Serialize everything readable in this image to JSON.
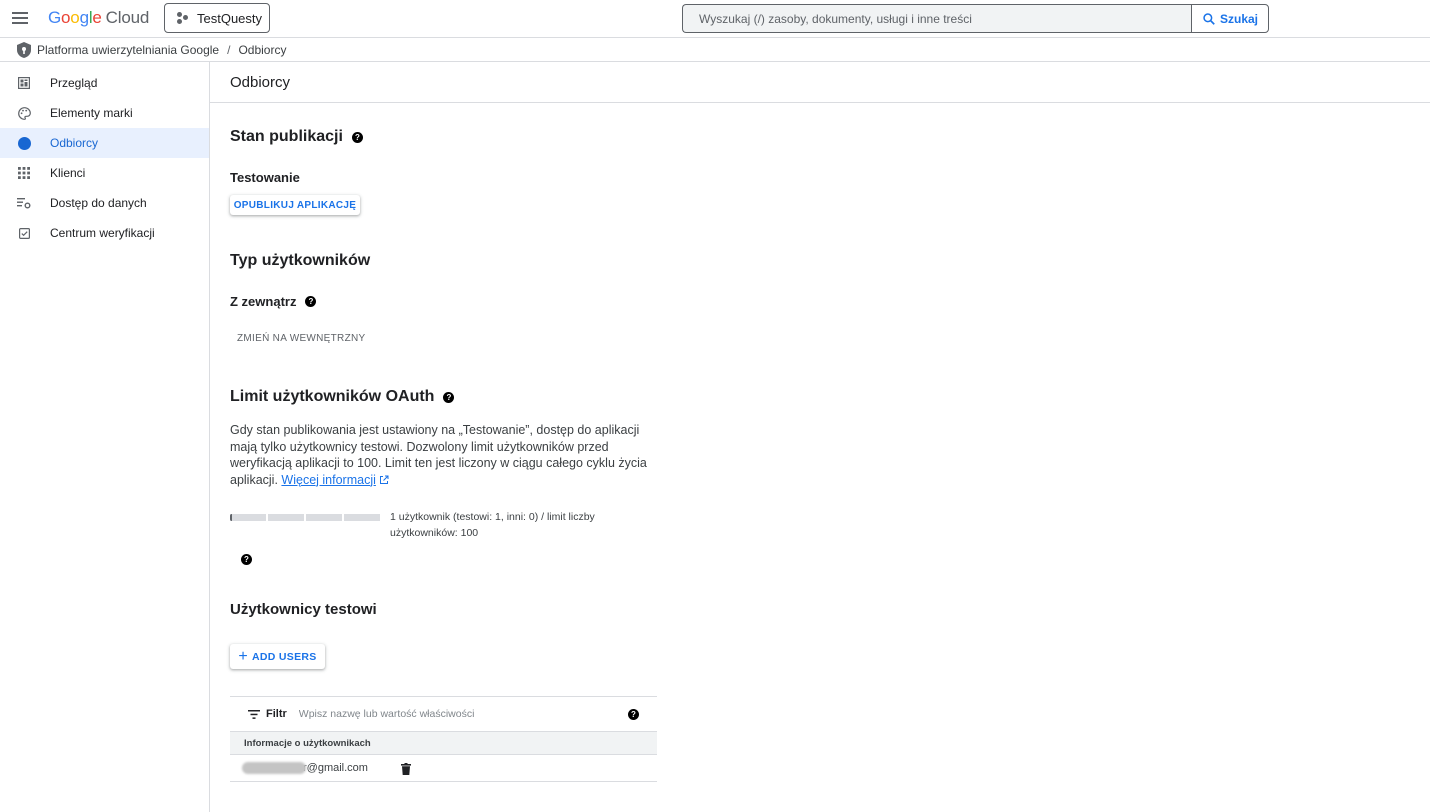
{
  "topbar": {
    "logo_google": "Google",
    "logo_cloud": "Cloud",
    "project_name": "TestQuesty",
    "search_placeholder": "Wyszukaj (/) zasoby, dokumenty, usługi i inne treści",
    "search_button": "Szukaj"
  },
  "breadcrumb": {
    "parent": "Platforma uwierzytelniania Google",
    "current": "Odbiorcy"
  },
  "sidebar": {
    "items": [
      {
        "label": "Przegląd",
        "icon": "dashboard-icon",
        "active": false
      },
      {
        "label": "Elementy marki",
        "icon": "palette-icon",
        "active": false
      },
      {
        "label": "Odbiorcy",
        "icon": "account-circle-icon",
        "active": true
      },
      {
        "label": "Klienci",
        "icon": "apps-grid-icon",
        "active": false
      },
      {
        "label": "Dostęp do danych",
        "icon": "data-settings-icon",
        "active": false
      },
      {
        "label": "Centrum weryfikacji",
        "icon": "checkbox-icon",
        "active": false
      }
    ]
  },
  "main": {
    "page_title": "Odbiorcy",
    "publish_status": {
      "heading": "Stan publikacji",
      "status": "Testowanie",
      "publish_button": "OPUBLIKUJ APLIKACJĘ"
    },
    "user_type": {
      "heading": "Typ użytkowników",
      "value": "Z zewnątrz",
      "change_button": "ZMIEŃ NA WEWNĘTRZNY"
    },
    "oauth_limit": {
      "heading": "Limit użytkowników OAuth",
      "description": "Gdy stan publikowania jest ustawiony na „Testowanie”, dostęp do aplikacji mają tylko użytkownicy testowi. Dozwolony limit użytkowników przed weryfikacją aplikacji to 100. Limit ten jest liczony w ciągu całego cyklu życia aplikacji. ",
      "more_link": "Więcej informacji",
      "progress_fraction": 0.01,
      "usage_text": "1 użytkownik (testowi: 1, inni: 0) / limit liczby użytkowników: 100"
    },
    "test_users": {
      "heading": "Użytkownicy testowi",
      "add_button": "ADD USERS",
      "filter_label": "Filtr",
      "filter_placeholder": "Wpisz nazwę lub wartość właściwości",
      "column_header": "Informacje o użytkownikach",
      "rows": [
        {
          "email_visible": "r@gmail.com"
        }
      ]
    }
  }
}
